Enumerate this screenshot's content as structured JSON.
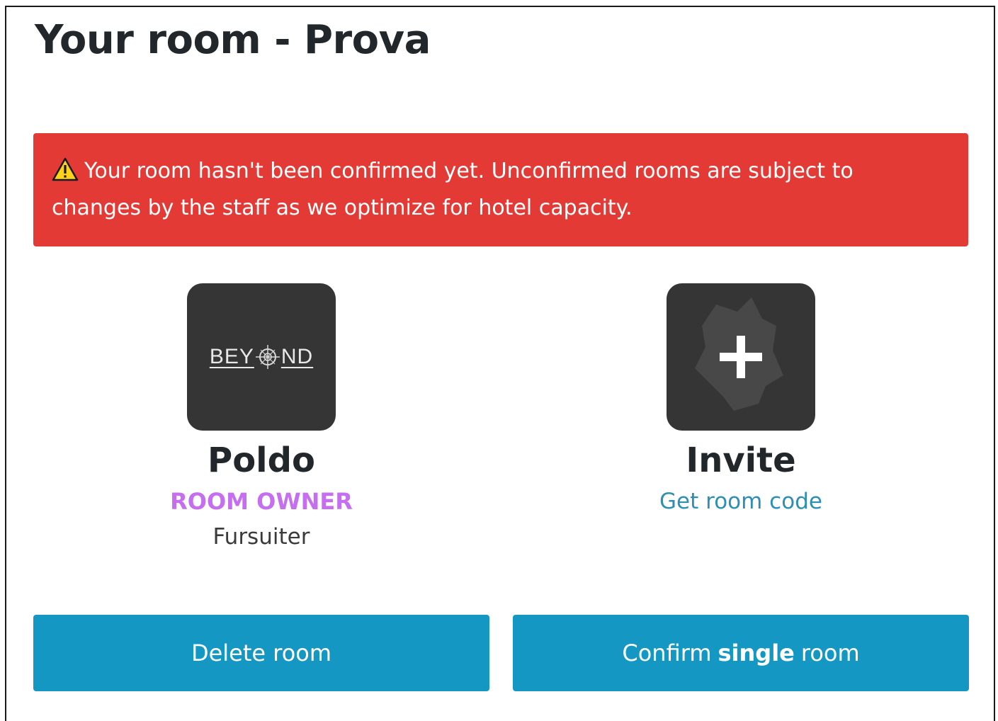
{
  "page": {
    "title": "Your room - Prova"
  },
  "alert": {
    "icon": "warning-icon",
    "message": "Your room hasn't been confirmed yet. Unconfirmed rooms are subject to changes by the staff as we optimize for hotel capacity.",
    "background": "#e33a36"
  },
  "members": {
    "owner": {
      "avatar_logo": "BEYOND",
      "name": "Poldo",
      "role": "ROOM OWNER",
      "type": "Fursuiter"
    },
    "invite": {
      "icon": "plus-icon",
      "name": "Invite",
      "link": "Get room code"
    }
  },
  "actions": {
    "delete_label": "Delete room",
    "confirm_prefix": "Confirm",
    "confirm_bold": "single",
    "confirm_suffix": "room",
    "button_color": "#1597c3"
  },
  "colors": {
    "role": "#c56ff0",
    "link": "#2e8fb5",
    "avatar_bg": "#353535"
  }
}
